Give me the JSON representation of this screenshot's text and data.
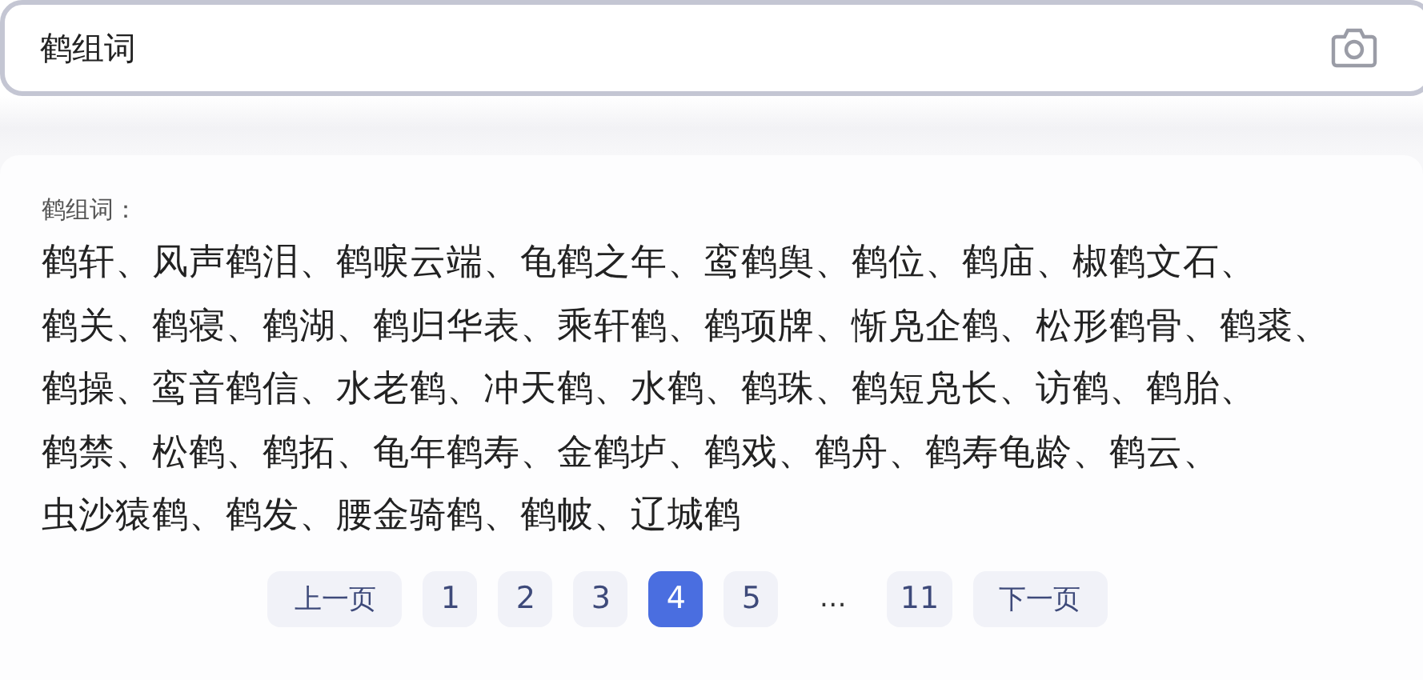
{
  "search": {
    "value": "鹤组词"
  },
  "result": {
    "label": "鹤组词：",
    "lines": [
      "鹤轩、风声鹤泪、鹤唳云端、龟鹤之年、鸾鹤舆、鹤位、鹤庙、椒鹤文石、",
      "鹤关、鹤寝、鹤湖、鹤归华表、乘轩鹤、鹤项牌、惭凫企鹤、松形鹤骨、鹤裘、",
      "鹤操、鸾音鹤信、水老鹤、冲天鹤、水鹤、鹤珠、鹤短凫长、访鹤、鹤胎、",
      "鹤禁、松鹤、鹤拓、龟年鹤寿、金鹤垆、鹤戏、鹤舟、鹤寿龟龄、鹤云、",
      "虫沙猿鹤、鹤发、腰金骑鹤、鹤帔、辽城鹤"
    ]
  },
  "pagination": [
    {
      "kind": "prev",
      "label": "上一页"
    },
    {
      "kind": "page",
      "label": "1",
      "selected": false
    },
    {
      "kind": "page",
      "label": "2",
      "selected": false
    },
    {
      "kind": "page",
      "label": "3",
      "selected": false
    },
    {
      "kind": "page",
      "label": "4",
      "selected": true
    },
    {
      "kind": "page",
      "label": "5",
      "selected": false
    },
    {
      "kind": "ellipsis",
      "label": "…"
    },
    {
      "kind": "page",
      "label": "11",
      "selected": false
    },
    {
      "kind": "next",
      "label": "下一页"
    }
  ]
}
